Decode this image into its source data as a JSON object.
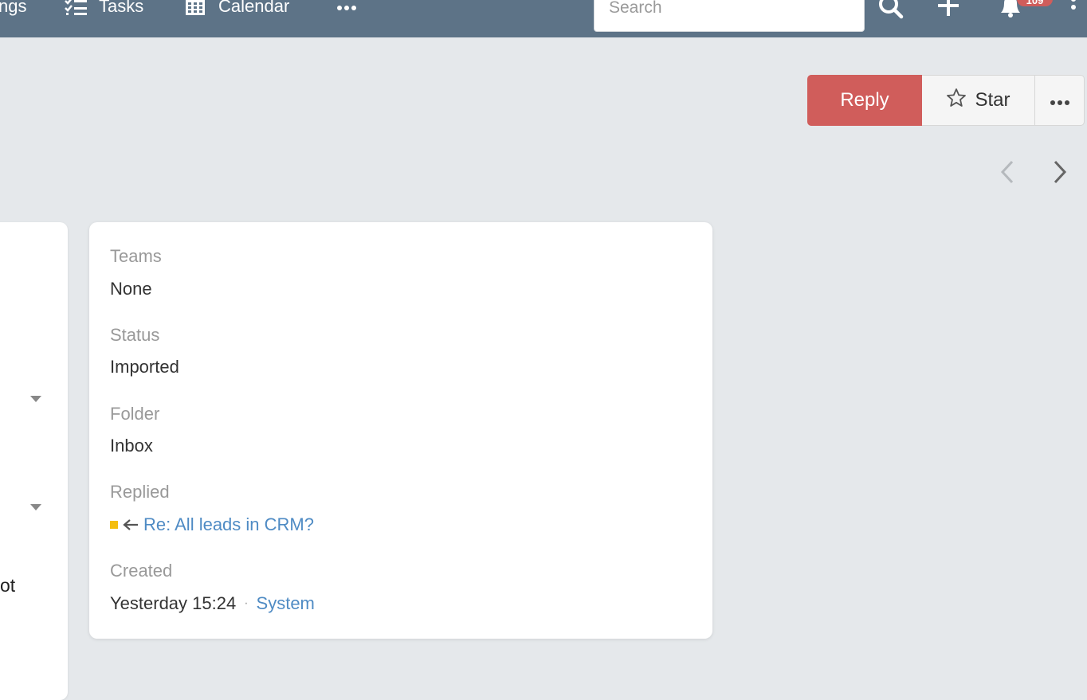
{
  "navbar": {
    "partial_item_label": "ngs",
    "tasks_label": "Tasks",
    "calendar_label": "Calendar",
    "search_placeholder": "Search",
    "notification_count": "109"
  },
  "actions": {
    "reply_label": "Reply",
    "star_label": "Star"
  },
  "left_panel": {
    "partial_text": "ot"
  },
  "details": {
    "teams_label": "Teams",
    "teams_value": "None",
    "status_label": "Status",
    "status_value": "Imported",
    "folder_label": "Folder",
    "folder_value": "Inbox",
    "replied_label": "Replied",
    "replied_link": "Re: All leads in CRM?",
    "created_label": "Created",
    "created_time": "Yesterday 15:24",
    "created_by": "System"
  },
  "colors": {
    "navbar": "#5d7387",
    "reply_button": "#d05d5b",
    "link": "#4f8bc4",
    "status_square": "#f4be0f",
    "background": "#e5e8eb"
  },
  "icons": {
    "tasks": "tasks-icon",
    "calendar": "calendar-icon",
    "more": "more-horizontal-icon",
    "search": "search-icon",
    "add": "plus-icon",
    "notifications": "bell-icon",
    "menu": "more-vertical-icon",
    "star": "star-icon",
    "prev": "chevron-left-icon",
    "next": "chevron-right-icon",
    "reply_arrow": "arrow-left-icon"
  }
}
